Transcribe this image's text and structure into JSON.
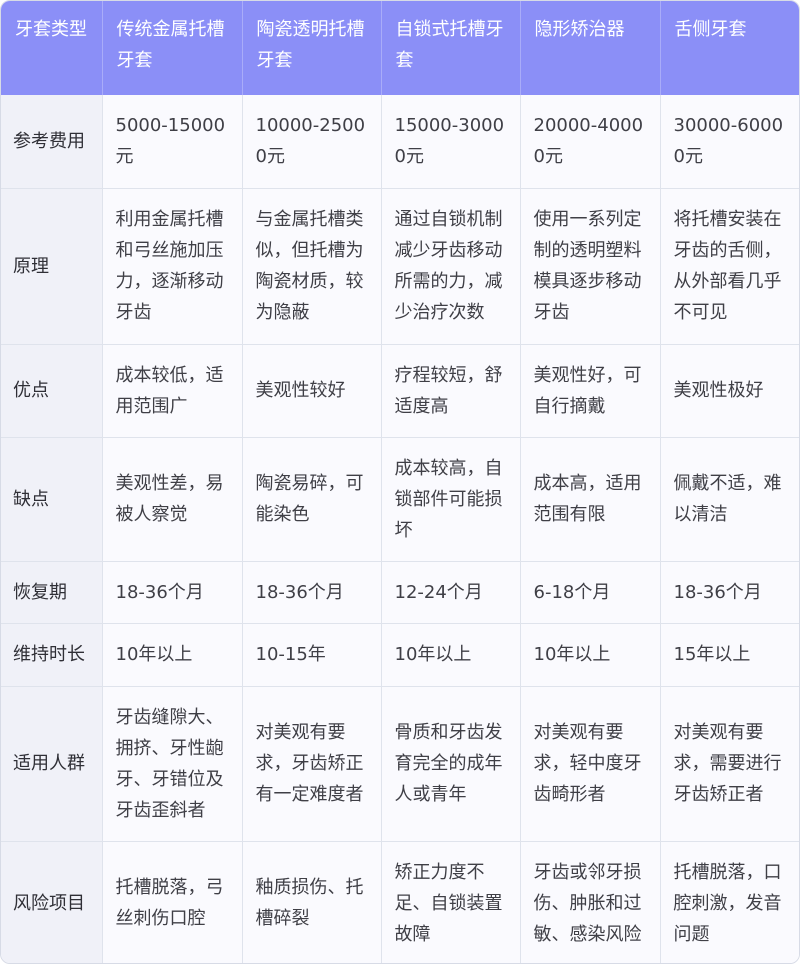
{
  "header": [
    "牙套类型",
    "传统金属托槽牙套",
    "陶瓷透明托槽牙套",
    "自锁式托槽牙套",
    "隐形矫治器",
    "舌侧牙套"
  ],
  "rows": [
    {
      "label": "参考费用",
      "cells": [
        "5000-15000元",
        "10000-25000元",
        "15000-30000元",
        "20000-40000元",
        "30000-60000元"
      ]
    },
    {
      "label": "原理",
      "cells": [
        "利用金属托槽和弓丝施加压力，逐渐移动牙齿",
        "与金属托槽类似，但托槽为陶瓷材质，较为隐蔽",
        "通过自锁机制减少牙齿移动所需的力，减少治疗次数",
        "使用一系列定制的透明塑料模具逐步移动牙齿",
        "将托槽安装在牙齿的舌侧，从外部看几乎不可见"
      ]
    },
    {
      "label": "优点",
      "cells": [
        "成本较低，适用范围广",
        "美观性较好",
        "疗程较短，舒适度高",
        "美观性好，可自行摘戴",
        "美观性极好"
      ]
    },
    {
      "label": "缺点",
      "cells": [
        "美观性差，易被人察觉",
        "陶瓷易碎，可能染色",
        "成本较高，自锁部件可能损坏",
        "成本高，适用范围有限",
        "佩戴不适，难以清洁"
      ]
    },
    {
      "label": "恢复期",
      "cells": [
        "18-36个月",
        "18-36个月",
        "12-24个月",
        "6-18个月",
        "18-36个月"
      ]
    },
    {
      "label": "维持时长",
      "cells": [
        "10年以上",
        "10-15年",
        "10年以上",
        "10年以上",
        "15年以上"
      ]
    },
    {
      "label": "适用人群",
      "cells": [
        "牙齿缝隙大、拥挤、牙性龅牙、牙错位及牙齿歪斜者",
        "对美观有要求，牙齿矫正有一定难度者",
        "骨质和牙齿发育完全的成年人或青年",
        "对美观有要求，轻中度牙齿畸形者",
        "对美观有要求，需要进行牙齿矫正者"
      ]
    },
    {
      "label": "风险项目",
      "cells": [
        "托槽脱落，弓丝刺伤口腔",
        "釉质损伤、托槽碎裂",
        "矫正力度不足、自锁装置故障",
        "牙齿或邻牙损伤、肿胀和过敏、感染风险",
        "托槽脱落，口腔刺激，发音问题"
      ]
    }
  ]
}
